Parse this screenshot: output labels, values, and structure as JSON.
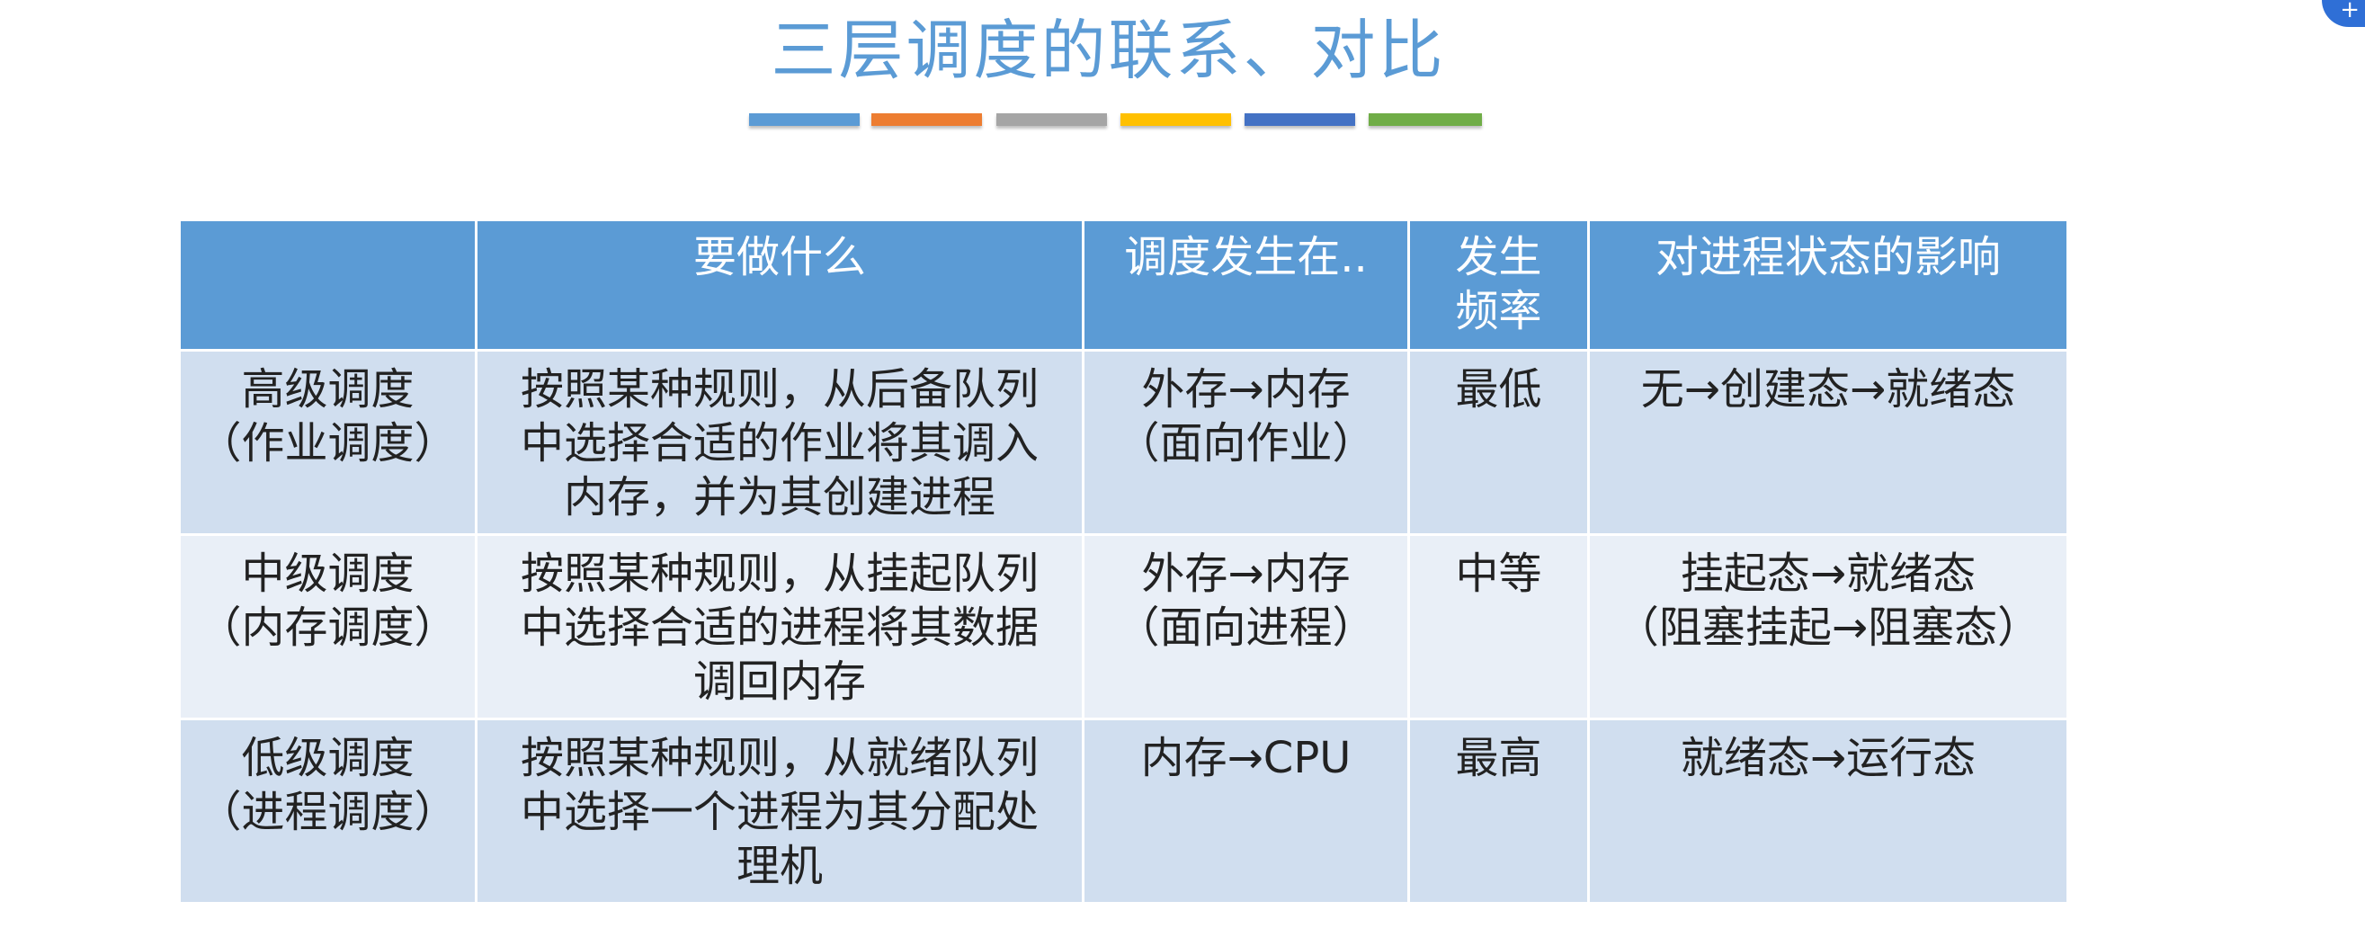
{
  "title": "三层调度的联系、对比",
  "accent_bars": [
    {
      "color": "#5b9bd5"
    },
    {
      "color": "#ed7d31"
    },
    {
      "color": "#a5a5a5"
    },
    {
      "color": "#ffc000"
    },
    {
      "color": "#4472c4"
    },
    {
      "color": "#70ad47"
    }
  ],
  "table": {
    "headers": [
      "",
      "要做什么",
      "调度发生在..",
      "发生频率",
      "对进程状态的影响"
    ],
    "rows": [
      {
        "name": "高级调度\n（作业调度）",
        "task": "按照某种规则，从后备队列中选择合适的作业将其调入内存，并为其创建进程",
        "where": "外存→内存\n（面向作业）",
        "freq": "最低",
        "effect": "无→创建态→就绪态"
      },
      {
        "name": "中级调度\n（内存调度）",
        "task": "按照某种规则，从挂起队列中选择合适的进程将其数据调回内存",
        "where": "外存→内存\n（面向进程）",
        "freq": "中等",
        "effect": "挂起态→就绪态\n（阻塞挂起→阻塞态）"
      },
      {
        "name": "低级调度\n（进程调度）",
        "task": "按照某种规则，从就绪队列中选择一个进程为其分配处理机",
        "where": "内存→CPU",
        "freq": "最高",
        "effect": "就绪态→运行态"
      }
    ]
  },
  "colors": {
    "header_bg": "#5b9bd5",
    "row_dark": "#d0deef",
    "row_light": "#e9eff7",
    "title": "#5b9bd5"
  }
}
